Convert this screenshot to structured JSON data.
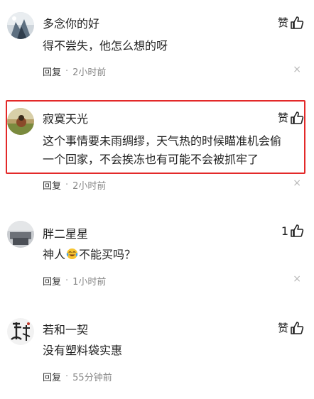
{
  "like_label": "赞",
  "reply_label": "回复",
  "dot": "·",
  "close_glyph": "×",
  "comments": [
    {
      "username": "多念你的好",
      "text": "得不尝失，他怎么想的呀",
      "time": "2小时前",
      "likes": ""
    },
    {
      "username": "寂寞天光",
      "text_line1": "这个事情要未雨绸缪，天气热的时候瞄准机会偷",
      "text_line2": "一个回家，不会挨冻也有可能不会被抓牢了",
      "time": "2小时前",
      "likes": ""
    },
    {
      "username": "胖二星星",
      "text_before": "神人",
      "emoji": "laughing-crying-emoji",
      "text_after": "不能买吗？",
      "time": "1小时前",
      "likes": "1"
    },
    {
      "username": "若和一契",
      "text": "没有塑料袋实惠",
      "time": "55分钟前",
      "likes": ""
    }
  ],
  "highlight_color": "#e32929"
}
